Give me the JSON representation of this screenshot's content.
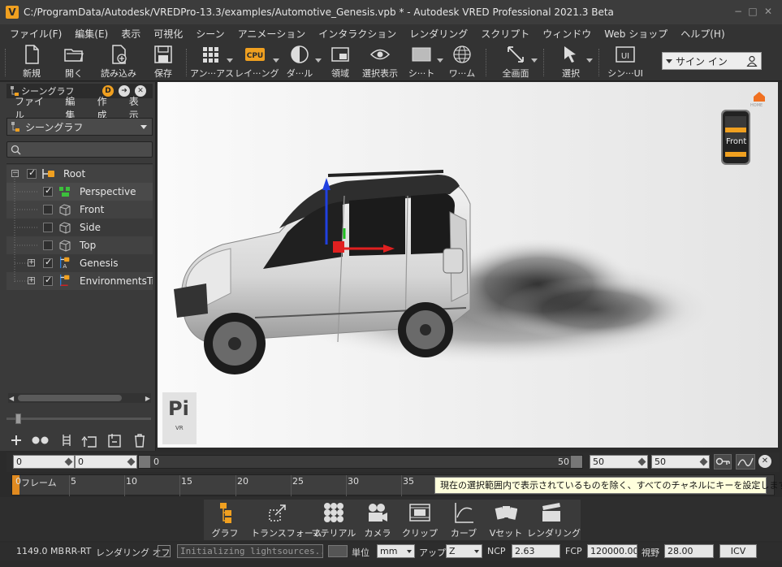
{
  "window": {
    "title": "C:/ProgramData/Autodesk/VREDPro-13.3/examples/Automotive_Genesis.vpb * - Autodesk VRED Professional 2021.3 Beta",
    "logo_letter": "V"
  },
  "menubar": [
    "ファイル(F)",
    "編集(E)",
    "表示",
    "可視化",
    "シーン",
    "アニメーション",
    "インタラクション",
    "レンダリング",
    "スクリプト",
    "ウィンドウ",
    "Web ショップ",
    "ヘルプ(H)"
  ],
  "toolbar": {
    "new": "新規",
    "open": "開く",
    "import": "読み込み",
    "save": "保存",
    "ambient": "アン···アス",
    "raytracing": "レイ···ング",
    "cpu_badge": "CPU",
    "doubleside": "ダ···ル",
    "region": "領域",
    "selection_display": "選択表示",
    "sheet": "シ···ト",
    "wire": "ワ···ム",
    "fullscreen": "全画面",
    "select": "選択",
    "scene_ui": "シン···UI",
    "ui_badge": "UI",
    "signin": "サイン イン"
  },
  "scenegraph_panel": {
    "title": "シーングラフ",
    "badge_d": "D",
    "menu": [
      "ファイル",
      "編集",
      "作成",
      "表示"
    ],
    "view_select": "シーングラフ",
    "tree": [
      {
        "label": "Root",
        "checked": true
      },
      {
        "label": "Perspective",
        "checked": true
      },
      {
        "label": "Front",
        "checked": false
      },
      {
        "label": "Side",
        "checked": false
      },
      {
        "label": "Top",
        "checked": false
      },
      {
        "label": "Genesis",
        "checked": true
      },
      {
        "label": "EnvironmentsTransform",
        "checked": true
      }
    ]
  },
  "viewport": {
    "navcube_face": "Front",
    "home_label": "HOME",
    "pi_logo": "Pi",
    "pi_sub": "VR"
  },
  "timeline": {
    "start_value": "0",
    "start2_value": "0",
    "range_start": "0",
    "range_end": "50",
    "end_value": "50",
    "end2_value": "50",
    "frame_label": "フレーム",
    "ticks": [
      "0",
      "5",
      "10",
      "15",
      "20",
      "25",
      "30",
      "35"
    ],
    "tooltip": "現在の選択範囲内で表示されているものを除く、すべてのチャネルにキーを設定します。"
  },
  "modules": [
    "グラフ",
    "トランスフォーム",
    "マテリアル",
    "カメラ",
    "クリップ",
    "カーブ",
    "Vセット",
    "レンダリング"
  ],
  "statusbar": {
    "memory": "1149.0 MB",
    "mode": "RR-RT",
    "render_off": "レンダリング オフ",
    "message": "Initializing lightsources...",
    "unit_label": "単位",
    "unit": "mm",
    "up_label": "アップ",
    "up": "Z",
    "ncp_label": "NCP",
    "ncp": "2.63",
    "fcp_label": "FCP",
    "fcp": "120000.00",
    "fov_label": "視野",
    "fov": "28.00",
    "icv": "ICV"
  },
  "colors": {
    "accent": "#f0a020",
    "background": "#2b2b2b",
    "viewport": "#f2f2f2",
    "tooltip": "#ffffdc"
  }
}
